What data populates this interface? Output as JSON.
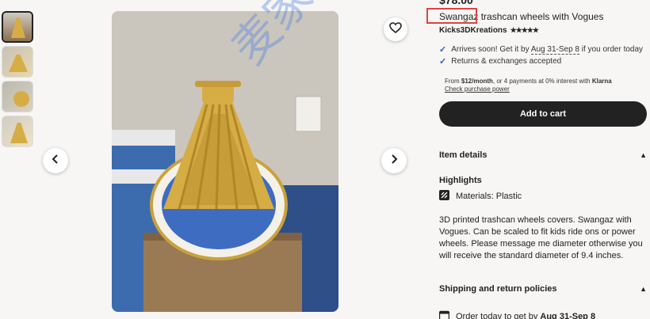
{
  "listing": {
    "price": "$78.00",
    "title_highlight": "Swangaz",
    "title_rest": " trashcan wheels with Vogues",
    "shop_name": "Kicks3DKreations",
    "rating": "★★★★★",
    "arrives_prefix": "Arrives soon! Get it by ",
    "arrives_date": "Aug 31-Sep 8",
    "arrives_suffix": " if you order today",
    "returns": "Returns & exchanges accepted",
    "klarna_prefix": "From ",
    "klarna_amount": "$12/month",
    "klarna_mid": ", or 4 payments at 0% interest with ",
    "klarna_brand": "Klarna",
    "klarna_link": "Check purchase power",
    "cart_label": "Add to cart"
  },
  "item_details": {
    "heading": "Item details",
    "highlights_label": "Highlights",
    "material": "Materials: Plastic",
    "description": "3D printed trashcan wheels covers. Swangaz with Vogues. Can be scaled to fit kids ride ons or power wheels. Please message me diameter otherwise you will receive the standard diameter of 9.4 inches."
  },
  "shipping": {
    "heading": "Shipping and return policies",
    "order_prefix": "Order today to get by ",
    "order_date": "Aug 31-Sep 8"
  },
  "watermark": "麦家星球",
  "colors": {
    "accent": "#2a60c8",
    "button": "#222222",
    "highlight_box": "#dd4444",
    "product": "#d6ad45"
  }
}
